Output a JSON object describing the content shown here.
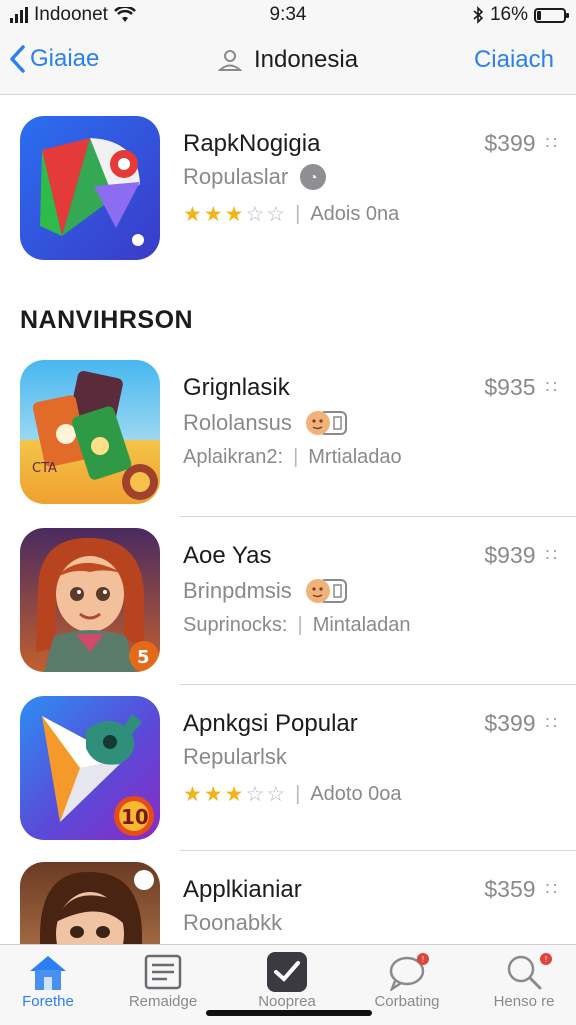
{
  "status_bar": {
    "carrier": "Indoonet",
    "time": "9:34",
    "battery": "16%",
    "battery_level": 0.16
  },
  "nav": {
    "back_label": "Giaiae",
    "title": "Indonesia",
    "action_label": "Ciaiach"
  },
  "top_app": {
    "name": "RapkNogigia",
    "subtitle": "Ropulaslar",
    "rating": 3.5,
    "meta": "Adois 0na",
    "price": "$399"
  },
  "section_title": "NANVIHRSON",
  "apps": [
    {
      "name": "Grignlasik",
      "subtitle": "Rololansus",
      "meta_left": "Aplaikran2:",
      "meta_right": "Mrtialadao",
      "price": "$935"
    },
    {
      "name": "Aoe Yas",
      "subtitle": "Brinpdmsis",
      "meta_left": "Suprinocks:",
      "meta_right": "Mintaladan",
      "price": "$939"
    },
    {
      "name": "Apnkgsi Popular",
      "subtitle": "Repularlsk",
      "rating": 3,
      "meta": "Adoto 0oa",
      "price": "$399"
    },
    {
      "name": "Applkianiar",
      "subtitle": "Roonabkk",
      "price": "$359"
    }
  ],
  "tabs": [
    {
      "label": "Forethe",
      "icon": "house-icon",
      "active": true
    },
    {
      "label": "Remaidge",
      "icon": "news-icon"
    },
    {
      "label": "Nooprea",
      "icon": "check-app-icon"
    },
    {
      "label": "Corbating",
      "icon": "chat-bubble-icon",
      "badge": true
    },
    {
      "label": "Henso re",
      "icon": "search-icon",
      "badge": true
    }
  ],
  "colors": {
    "accent": "#2a7ff2",
    "star": "#f5b31a",
    "badge": "#e0443a"
  }
}
